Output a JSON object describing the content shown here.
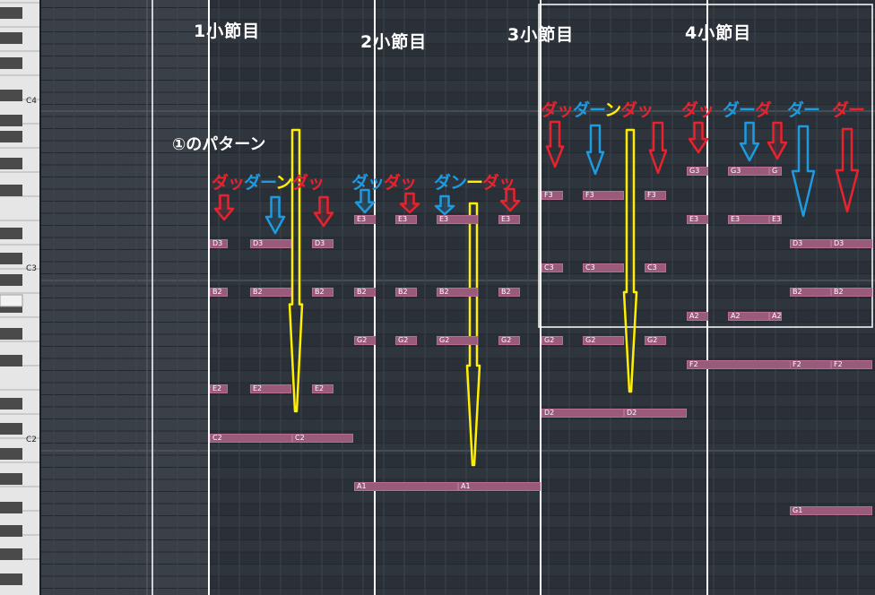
{
  "keyboard": {
    "octave_labels": [
      "C4",
      "C3",
      "C2"
    ]
  },
  "bars": [
    "1小節目",
    "2小節目",
    "3小節目",
    "4小節目"
  ],
  "pattern_label": "①のパターン",
  "colors": {
    "red": "#e8222e",
    "blue": "#1e9be0",
    "yellow": "#ffef00",
    "note": "#9a5a7a",
    "note_border": "#b46e92"
  },
  "lyrics": [
    {
      "segments": [
        {
          "t": "ダッ",
          "c": "red"
        },
        {
          "t": "ダー",
          "c": "blue"
        },
        {
          "t": "ン",
          "c": "yellow"
        },
        {
          "t": "ダッ",
          "c": "red"
        }
      ]
    },
    {
      "segments": [
        {
          "t": "ダッ",
          "c": "blue"
        },
        {
          "t": "ダッ",
          "c": "red"
        }
      ]
    },
    {
      "segments": [
        {
          "t": "ダン",
          "c": "blue"
        },
        {
          "t": "ー",
          "c": "yellow"
        },
        {
          "t": "ダッ",
          "c": "red"
        }
      ]
    },
    {
      "segments": [
        {
          "t": "ダッ",
          "c": "red"
        },
        {
          "t": "ダー",
          "c": "blue"
        },
        {
          "t": "ン",
          "c": "yellow"
        },
        {
          "t": "ダッ",
          "c": "red"
        }
      ]
    },
    {
      "segments": [
        {
          "t": "ダッ",
          "c": "red"
        }
      ]
    },
    {
      "segments": [
        {
          "t": "ダー",
          "c": "blue"
        },
        {
          "t": "ダ",
          "c": "red"
        }
      ]
    },
    {
      "segments": [
        {
          "t": "ダー",
          "c": "blue"
        }
      ]
    },
    {
      "segments": [
        {
          "t": "ダー",
          "c": "red"
        }
      ]
    }
  ],
  "notes": [
    {
      "label": "D3"
    },
    {
      "label": "D3"
    },
    {
      "label": "D3"
    },
    {
      "label": "B2"
    },
    {
      "label": "B2"
    },
    {
      "label": "B2"
    },
    {
      "label": "E2"
    },
    {
      "label": "E2"
    },
    {
      "label": "E2"
    },
    {
      "label": "C2"
    },
    {
      "label": "C2"
    },
    {
      "label": "E3"
    },
    {
      "label": "E3"
    },
    {
      "label": "E3"
    },
    {
      "label": "E3"
    },
    {
      "label": "B2"
    },
    {
      "label": "B2"
    },
    {
      "label": "B2"
    },
    {
      "label": "B2"
    },
    {
      "label": "G2"
    },
    {
      "label": "G2"
    },
    {
      "label": "G2"
    },
    {
      "label": "G2"
    },
    {
      "label": "A1"
    },
    {
      "label": "A1"
    },
    {
      "label": "F3"
    },
    {
      "label": "F3"
    },
    {
      "label": "F3"
    },
    {
      "label": "C3"
    },
    {
      "label": "C3"
    },
    {
      "label": "C3"
    },
    {
      "label": "G2"
    },
    {
      "label": "G2"
    },
    {
      "label": "G2"
    },
    {
      "label": "D2"
    },
    {
      "label": "D2"
    },
    {
      "label": "G3"
    },
    {
      "label": "G3"
    },
    {
      "label": "G"
    },
    {
      "label": "E3"
    },
    {
      "label": "E3"
    },
    {
      "label": "E3"
    },
    {
      "label": "A2"
    },
    {
      "label": "A2"
    },
    {
      "label": "A2"
    },
    {
      "label": "F2"
    },
    {
      "label": "F2"
    },
    {
      "label": "F2"
    },
    {
      "label": "D3"
    },
    {
      "label": "D3"
    },
    {
      "label": "B2"
    },
    {
      "label": "B2"
    },
    {
      "label": "G1"
    }
  ],
  "arrows": [
    {
      "c": "red",
      "size": "small"
    },
    {
      "c": "blue",
      "size": "small"
    },
    {
      "c": "red",
      "size": "small"
    },
    {
      "c": "blue",
      "size": "small"
    },
    {
      "c": "red",
      "size": "small"
    },
    {
      "c": "blue",
      "size": "small"
    },
    {
      "c": "red",
      "size": "small"
    },
    {
      "c": "red",
      "size": "medium"
    },
    {
      "c": "blue",
      "size": "medium"
    },
    {
      "c": "red",
      "size": "medium"
    },
    {
      "c": "red",
      "size": "small"
    },
    {
      "c": "blue",
      "size": "small"
    },
    {
      "c": "red",
      "size": "small"
    },
    {
      "c": "blue",
      "size": "long"
    },
    {
      "c": "red",
      "size": "long"
    },
    {
      "c": "yellow",
      "size": "tall"
    },
    {
      "c": "yellow",
      "size": "tall"
    },
    {
      "c": "yellow",
      "size": "tall"
    }
  ]
}
